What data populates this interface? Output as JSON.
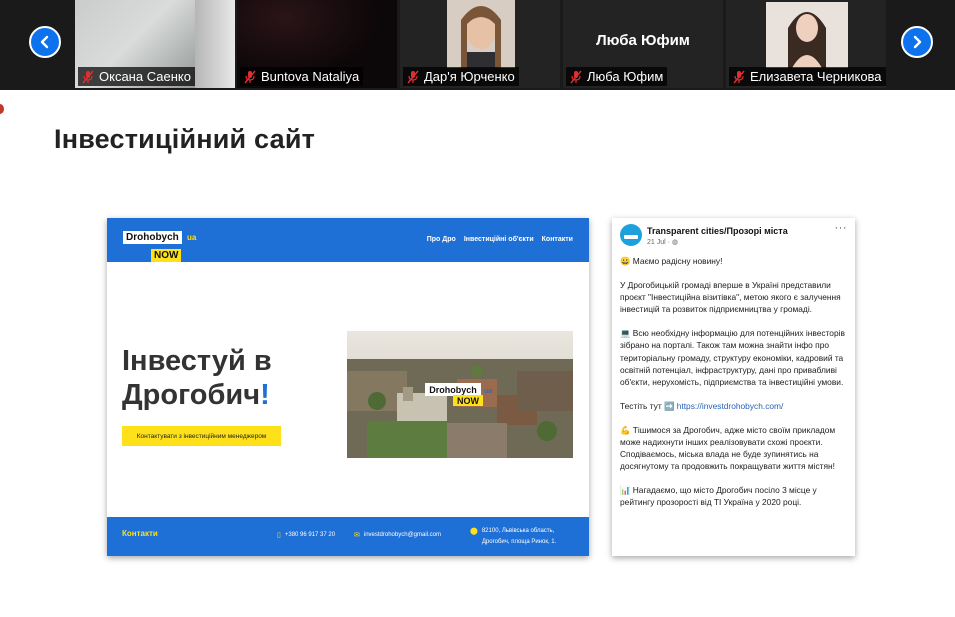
{
  "meeting": {
    "prev_label": "",
    "next_label": "",
    "participants": [
      {
        "name": "Оксана Саенко",
        "muted": true,
        "video": "blurred-room"
      },
      {
        "name": "Buntova Nataliya",
        "muted": true,
        "video": "dark"
      },
      {
        "name": "Дар'я Юрченко",
        "muted": true,
        "video": "person"
      },
      {
        "name": "Люба Юфим",
        "muted": true,
        "video": "none"
      },
      {
        "name": "Елизавета Черникова",
        "muted": true,
        "video": "person"
      }
    ]
  },
  "slide": {
    "title": "Інвестиційний сайт"
  },
  "website": {
    "logo_line1": "Drohobych",
    "logo_line2": "NOW",
    "logo_suffix": "ua",
    "nav": [
      "Про Дро",
      "Інвестиційні об'єкти",
      "Контакти"
    ],
    "hero_line1": "Інвестуй в",
    "hero_line2": "Дрогобич",
    "hero_bang": "!",
    "cta": "Контактувати з інвестиційним менеджером",
    "photo_logo1": "Drohobych",
    "photo_logo2": "NOW",
    "photo_logo3": "ua",
    "footer_contacts": "Контакти",
    "phone": "+380 96 917 37 20",
    "email": "investdrohobych@gmail.com",
    "address_line1": "82100, Львівська область,",
    "address_line2": "Дрогобич, площа Ринок, 1.",
    "accent": "#1e6fd6",
    "highlight": "#ffe11a"
  },
  "post": {
    "page_name": "Transparent cities/Прозорі міста",
    "date": "21 Jul ·",
    "more": "···",
    "paragraphs": [
      "😀 Маємо радісну новину!",
      "У Дрогобицькій громаді вперше в Україні представили проєкт \"Інвестиційна візитівка\", метою якого є залучення інвестицій та розвиток підприємництва у громаді.",
      "💻 Всю необхідну інформацію для потенційних інвесторів зібрано на порталі. Також там можна знайти інфо про територіальну громаду, структуру економіки, кадровий та освітній потенціал, інфраструктуру, дані про привабливі об'єкти, нерухомість, підприємства та інвестиційні умови.",
      "💪 Тішимося за Дрогобич, адже місто своїм прикладом може надихнути інших реалізовувати схожі проєкти. Сподіваємось, міська влада не буде зупинятись на досягнутому та продовжить покращувати життя містян!",
      "📊 Нагадаємо, що місто Дрогобич посіло 3 місце у рейтингу прозорості від TI Україна у 2020 році."
    ],
    "test_prefix": "Тестіть тут ➡️ ",
    "test_link": "https://investdrohobych.com/"
  }
}
